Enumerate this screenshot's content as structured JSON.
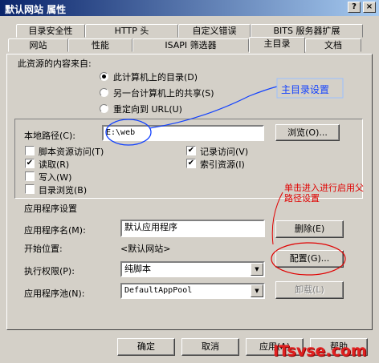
{
  "window": {
    "title": "默认网站 属性",
    "help_btn": "?",
    "close_btn": "×"
  },
  "tabs_back": [
    "目录安全性",
    "HTTP 头",
    "自定义错误",
    "BITS 服务器扩展"
  ],
  "tabs_front": [
    "网站",
    "性能",
    "ISAPI 筛选器",
    "主目录",
    "文档"
  ],
  "content_source": {
    "label": "此资源的内容来自:",
    "options": [
      "此计算机上的目录(D)",
      "另一台计算机上的共享(S)",
      "重定向到 URL(U)"
    ],
    "selected": 0
  },
  "local_path": {
    "label": "本地路径(C):",
    "value": "E:\\web",
    "browse_btn": "浏览(O)..."
  },
  "checks_left": [
    {
      "label": "脚本资源访问(T)",
      "checked": false
    },
    {
      "label": "读取(R)",
      "checked": true
    },
    {
      "label": "写入(W)",
      "checked": false
    },
    {
      "label": "目录浏览(B)",
      "checked": false
    }
  ],
  "checks_right": [
    {
      "label": "记录访问(V)",
      "checked": true
    },
    {
      "label": "索引资源(I)",
      "checked": true
    }
  ],
  "app_settings": {
    "section_label": "应用程序设置",
    "app_name_label": "应用程序名(M):",
    "app_name_value": "默认应用程序",
    "delete_btn": "删除(E)",
    "start_label": "开始位置:",
    "start_value": "<默认网站>",
    "config_btn": "配置(G)...",
    "exec_label": "执行权限(P):",
    "exec_value": "纯脚本",
    "pool_label": "应用程序池(N):",
    "pool_value": "DefaultAppPool",
    "unload_btn": "卸载(L)"
  },
  "footer": {
    "ok": "确定",
    "cancel": "取消",
    "apply": "应用(A)",
    "help": "帮助"
  },
  "annotations": {
    "blue": "主目录设置",
    "red": "单击进入进行启用父路径设置"
  },
  "watermark": "ITsvse.com",
  "icons": {
    "checkmark": "✔",
    "dropdown": "▼"
  }
}
